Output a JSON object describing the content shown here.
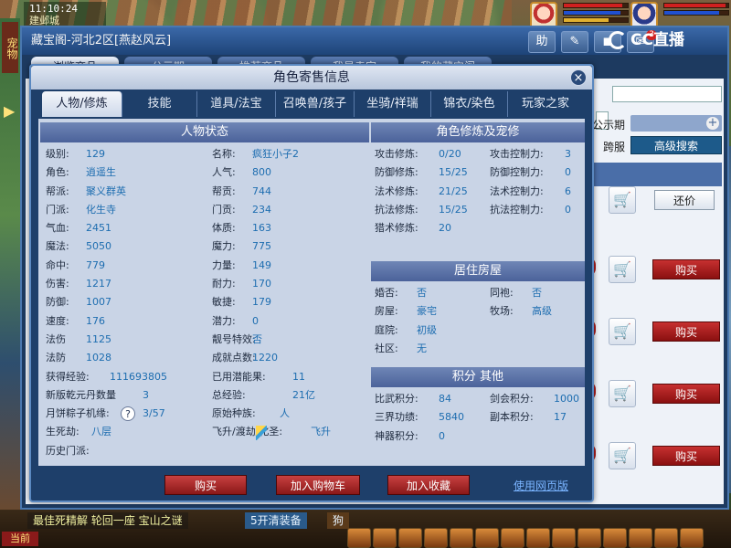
{
  "hud": {
    "time": "11:10:24",
    "city": "建邺城",
    "vertical_label": "宠物",
    "current_label": "当前"
  },
  "cbg": {
    "title": "藏宝阁-河北2区[燕赵风云]",
    "toolbar": [
      "助",
      "✎",
      "◼",
      "✉"
    ],
    "mail_count": "3",
    "tabs": [
      "浏览商品",
      "公示期",
      "推荐商品",
      "我是卖家",
      "我的藏宝阁"
    ],
    "label_public": "公示期",
    "label_cross": "跨服",
    "advanced_search": "高级搜索",
    "bid_label": "还价",
    "buy_label": "购买",
    "item_markers": [
      "6",
      "9",
      "9",
      "1"
    ]
  },
  "cc_logo": "CC直播",
  "dialog": {
    "title": "角色寄售信息",
    "close": "×",
    "tabs": [
      "人物/修炼",
      "技能",
      "道具/法宝",
      "召唤兽/孩子",
      "坐骑/祥瑞",
      "锦衣/染色",
      "玩家之家"
    ],
    "status": {
      "heading": "人物状态",
      "left": [
        {
          "k": "级别:",
          "v": "129"
        },
        {
          "k": "角色:",
          "v": "逍遥生"
        },
        {
          "k": "帮派:",
          "v": "聚义群英"
        },
        {
          "k": "门派:",
          "v": "化生寺"
        },
        {
          "k": "气血:",
          "v": "2451"
        },
        {
          "k": "魔法:",
          "v": "5050"
        },
        {
          "k": "命中:",
          "v": "779"
        },
        {
          "k": "伤害:",
          "v": "1217"
        },
        {
          "k": "防御:",
          "v": "1007"
        },
        {
          "k": "速度:",
          "v": "176"
        },
        {
          "k": "法伤",
          "v": "1125"
        },
        {
          "k": "法防",
          "v": "1028"
        }
      ],
      "right": [
        {
          "k": "名称:",
          "v": "疯狂小子2"
        },
        {
          "k": "人气:",
          "v": "800"
        },
        {
          "k": "帮贡:",
          "v": "744"
        },
        {
          "k": "门贡:",
          "v": "234"
        },
        {
          "k": "体质:",
          "v": "163"
        },
        {
          "k": "魔力:",
          "v": "775"
        },
        {
          "k": "力量:",
          "v": "149"
        },
        {
          "k": "耐力:",
          "v": "170"
        },
        {
          "k": "敏捷:",
          "v": "179"
        },
        {
          "k": "潜力:",
          "v": "0"
        },
        {
          "k": "靓号特效:",
          "v": "否"
        },
        {
          "k": "成就点数:",
          "v": "1220"
        }
      ],
      "exp_label": "获得经验:",
      "exp_value": "111693805",
      "qiankun_label": "新版乾元丹数量",
      "qiankun_value": "3",
      "mooncake_label": "月饼粽子机缘:",
      "mooncake_value": "3/57",
      "help": "?",
      "shengsi_label": "生死劫:",
      "shengsi_value": "八层",
      "history_label": "历史门派:",
      "skill_used_label": "已用潜能果:",
      "skill_used_value": "11",
      "total_exp_label": "总经验:",
      "total_exp_value": "21亿",
      "race_label": "原始种族:",
      "race_value": "人",
      "fly_label": "飞升/渡劫/化圣:",
      "fly_value": "飞升"
    },
    "cultivation": {
      "heading": "角色修炼及宠修",
      "rows": [
        {
          "k1": "攻击修炼:",
          "v1": "0/20",
          "k2": "攻击控制力:",
          "v2": "3"
        },
        {
          "k1": "防御修炼:",
          "v1": "15/25",
          "k2": "防御控制力:",
          "v2": "0"
        },
        {
          "k1": "法术修炼:",
          "v1": "21/25",
          "k2": "法术控制力:",
          "v2": "6"
        },
        {
          "k1": "抗法修炼:",
          "v1": "15/25",
          "k2": "抗法控制力:",
          "v2": "0"
        },
        {
          "k1": "猎术修炼:",
          "v1": "20",
          "k2": "",
          "v2": ""
        }
      ]
    },
    "house": {
      "heading": "居住房屋",
      "rows": [
        {
          "k1": "婚否:",
          "v1": "否",
          "k2": "同袍:",
          "v2": "否"
        },
        {
          "k1": "房屋:",
          "v1": "豪宅",
          "k2": "牧场:",
          "v2": "高级"
        },
        {
          "k1": "庭院:",
          "v1": "初级",
          "k2": "",
          "v2": ""
        },
        {
          "k1": "社区:",
          "v1": "无",
          "k2": "",
          "v2": ""
        }
      ]
    },
    "score": {
      "heading": "积分 其他",
      "rows": [
        {
          "k1": "比武积分:",
          "v1": "84",
          "k2": "剑会积分:",
          "v2": "1000"
        },
        {
          "k1": "三界功绩:",
          "v1": "5840",
          "k2": "副本积分:",
          "v2": "17"
        },
        {
          "k1": "神器积分:",
          "v1": "0",
          "k2": "",
          "v2": ""
        }
      ]
    },
    "buttons": {
      "buy": "购买",
      "add_cart": "加入购物车",
      "favorite": "加入收藏",
      "web": "使用网页版"
    }
  },
  "chat": {
    "line": "最佳死精解 轮回一座 宝山之谜",
    "chip": "5开清装备",
    "chip2": "狗"
  }
}
